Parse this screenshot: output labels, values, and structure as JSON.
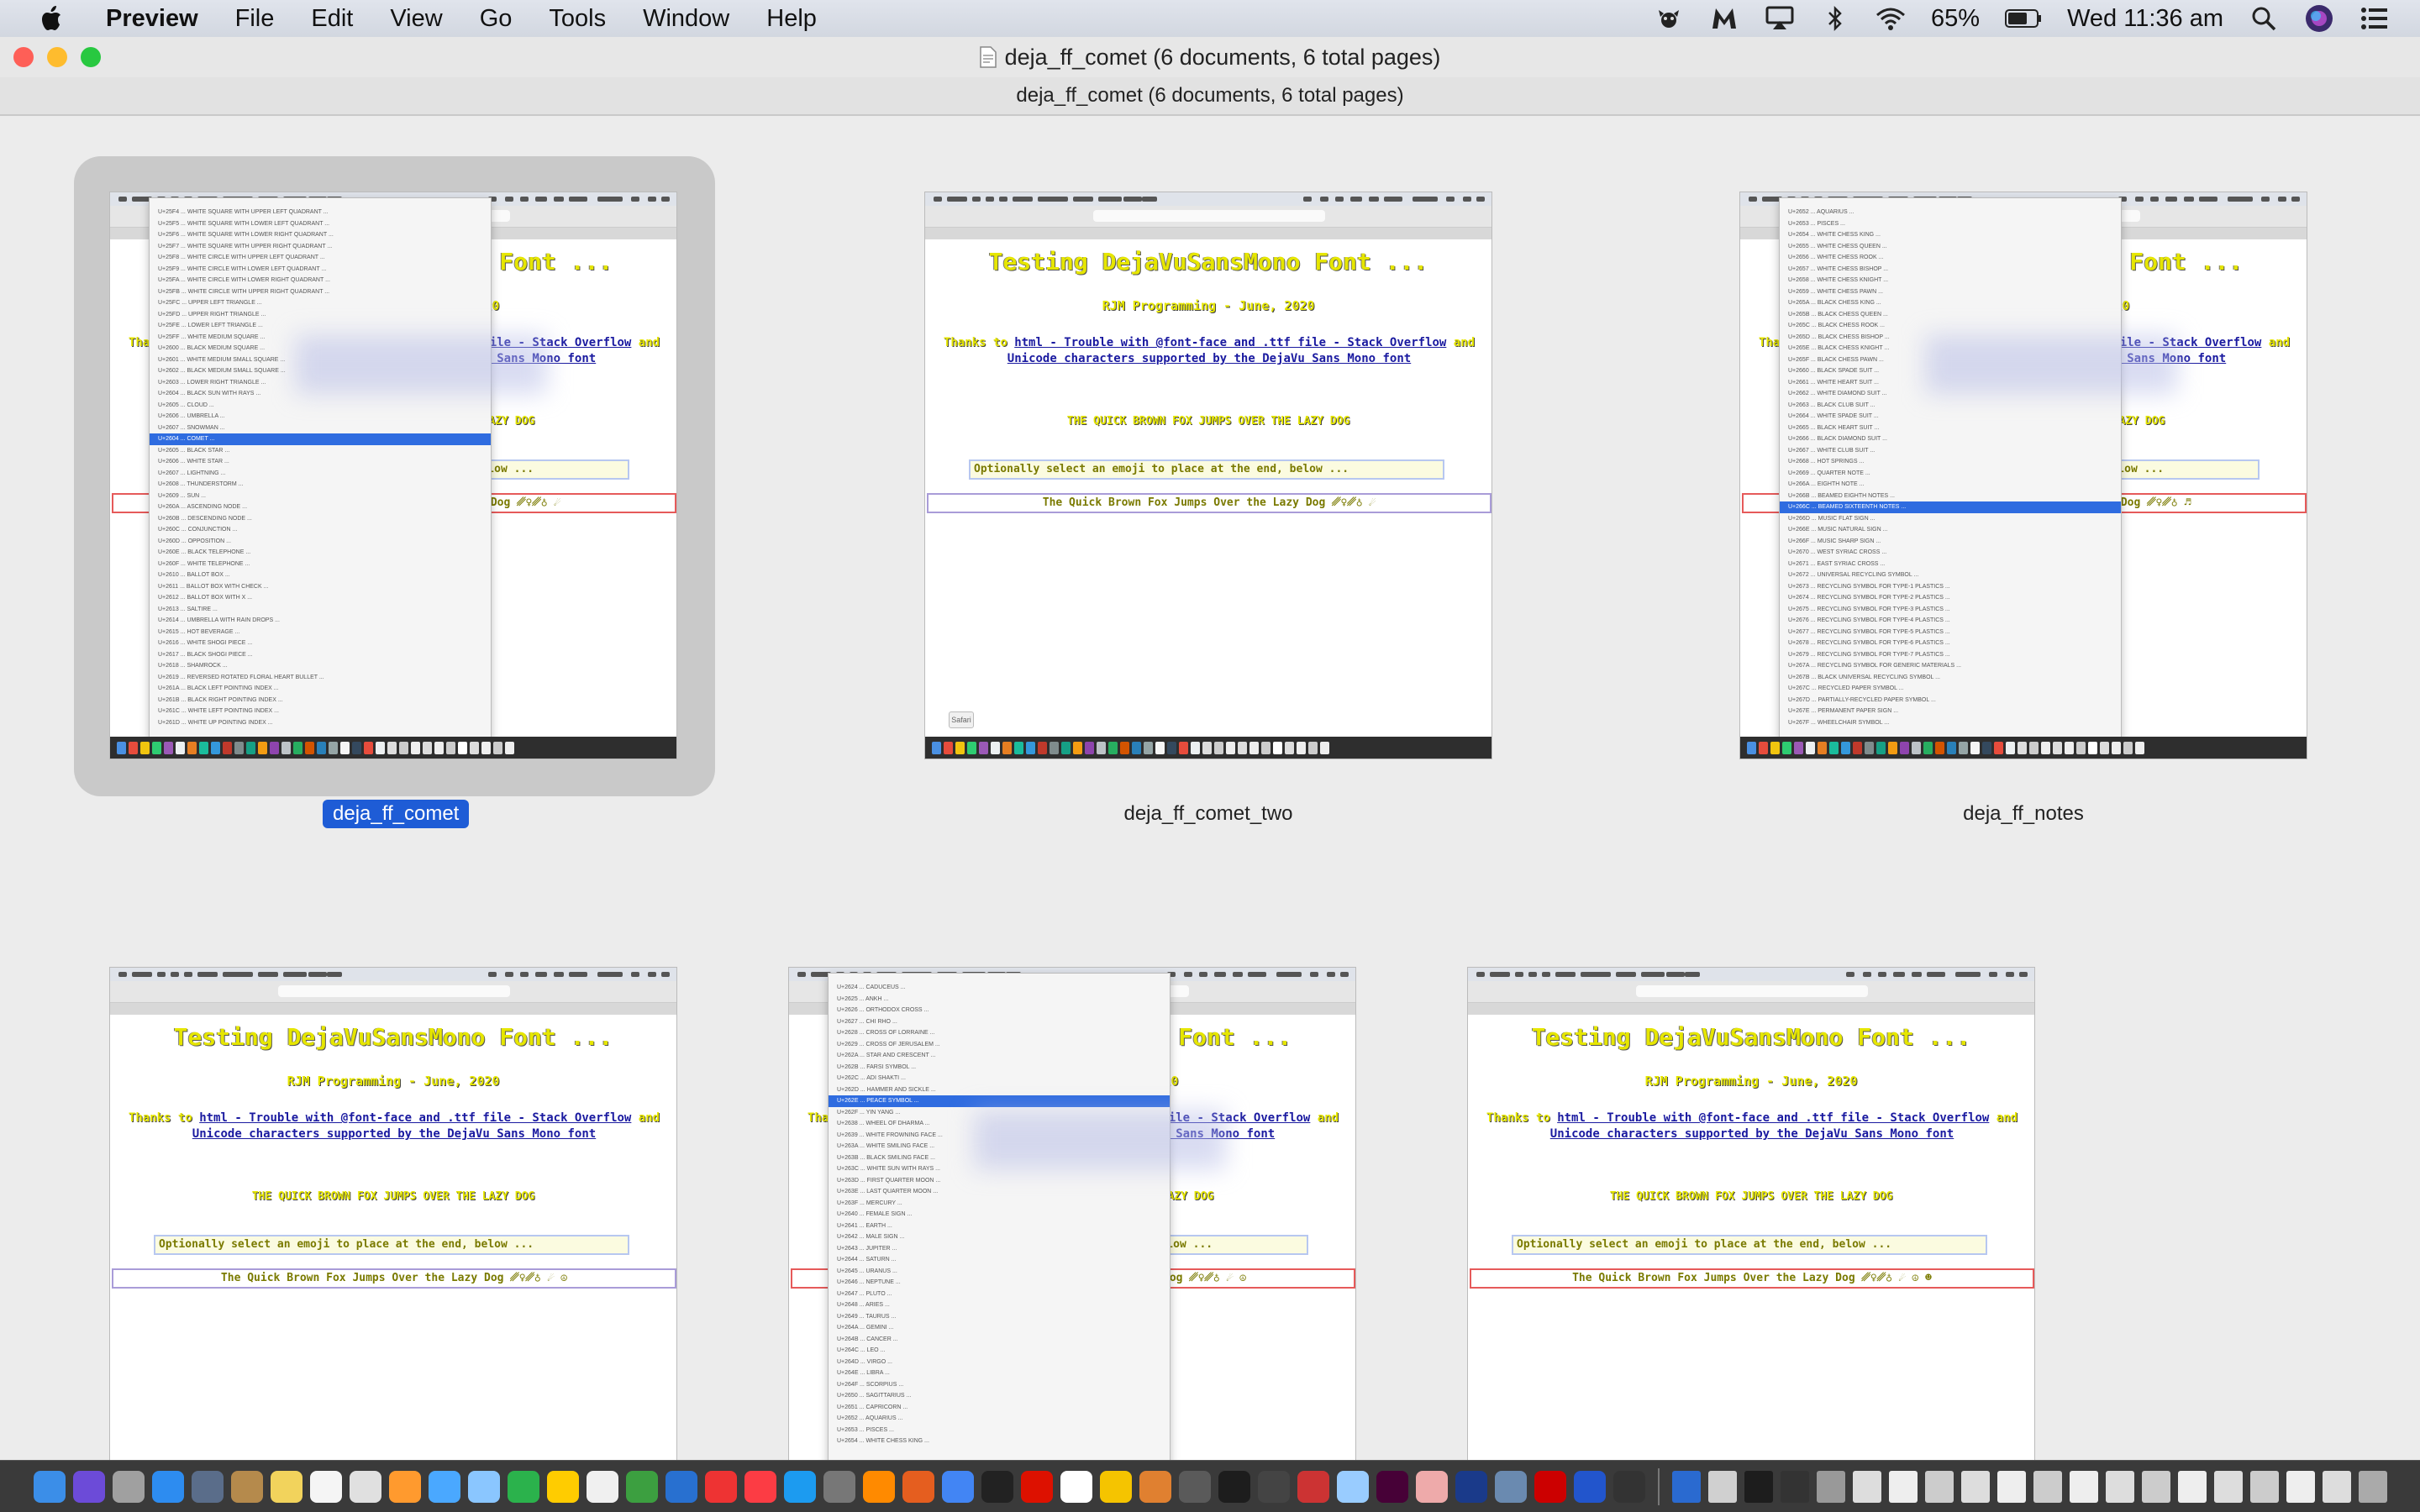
{
  "menubar": {
    "app_name": "Preview",
    "menus": [
      "File",
      "Edit",
      "View",
      "Go",
      "Tools",
      "Window",
      "Help"
    ],
    "battery": "65%",
    "clock": "Wed 11:36 am",
    "status_icons": [
      "automator-icon",
      "m-icon",
      "airplay-icon",
      "bluetooth-icon",
      "wifi-icon",
      "battery-icon",
      "search-icon",
      "siri-icon",
      "list-icon"
    ]
  },
  "window": {
    "title": "deja_ff_comet (6 documents, 6 total pages)",
    "subtitle": "deja_ff_comet (6 documents, 6 total pages)",
    "colors": {
      "close": "#fe5f57",
      "minimize": "#febc2e",
      "zoom": "#28c840",
      "selection": "#1e5cd6"
    }
  },
  "page_content": {
    "title": "Testing DejaVuSansMono Font ...",
    "byline": "RJM Programming - June, 2020",
    "thanks_prefix": "Thanks to",
    "link1": "html - Trouble with @font-face and .ttf file - Stack Overflow",
    "and": "and",
    "link2": "Unicode characters supported by the DejaVu Sans Mono font",
    "fox_caps": "THE QUICK BROWN FOX JUMPS OVER THE LAZY DOG",
    "select_prompt": "Optionally select an emoji to place at the end, below ...",
    "safari_button": "Safari"
  },
  "documents": [
    {
      "label": "deja_ff_comet",
      "output": "The Quick Brown Fox Jumps Over the Lazy Dog ␥♀␥♁ ☄",
      "selected": true
    },
    {
      "label": "deja_ff_comet_two",
      "output": "The Quick Brown Fox Jumps Over the Lazy Dog ␥♀␥♁ ☄",
      "selected": false
    },
    {
      "label": "deja_ff_notes",
      "output": "The Quick Brown Fox Jumps Over the Lazy Dog ␥♀␥♁ ♬",
      "selected": false
    },
    {
      "label": "",
      "output": "The Quick Brown Fox Jumps Over the Lazy Dog ␥♀␥♁ ☄ ☮",
      "selected": false
    },
    {
      "label": "",
      "output": "The Quick Brown Fox Jumps Over the Lazy Dog ␥♀␥♁ ☄ ☮",
      "selected": false
    },
    {
      "label": "",
      "output": "The Quick Brown Fox Jumps Over the Lazy Dog ␥♀␥♁ ☄ ☮ ☻",
      "selected": false
    }
  ],
  "dropdown_comet": {
    "rows": [
      "U+25F4 ... WHITE SQUARE WITH UPPER LEFT QUADRANT ...",
      "U+25F5 ... WHITE SQUARE WITH LOWER LEFT QUADRANT ...",
      "U+25F6 ... WHITE SQUARE WITH LOWER RIGHT QUADRANT ...",
      "U+25F7 ... WHITE SQUARE WITH UPPER RIGHT QUADRANT ...",
      "U+25F8 ... WHITE CIRCLE WITH UPPER LEFT QUADRANT ...",
      "U+25F9 ... WHITE CIRCLE WITH LOWER LEFT QUADRANT ...",
      "U+25FA ... WHITE CIRCLE WITH LOWER RIGHT QUADRANT ...",
      "U+25FB ... WHITE CIRCLE WITH UPPER RIGHT QUADRANT ...",
      "U+25FC ... UPPER LEFT TRIANGLE ...",
      "U+25FD ... UPPER RIGHT TRIANGLE ...",
      "U+25FE ... LOWER LEFT TRIANGLE ...",
      "U+25FF ... WHITE MEDIUM SQUARE ...",
      "U+2600 ... BLACK MEDIUM SQUARE ...",
      "U+2601 ... WHITE MEDIUM SMALL SQUARE ...",
      "U+2602 ... BLACK MEDIUM SMALL SQUARE ...",
      "U+2603 ... LOWER RIGHT TRIANGLE ...",
      "U+2604 ... BLACK SUN WITH RAYS ...",
      "U+2605 ... CLOUD ...",
      "U+2606 ... UMBRELLA ...",
      "U+2607 ... SNOWMAN ...",
      "U+2604 ... COMET ...",
      "U+2605 ... BLACK STAR ...",
      "U+2606 ... WHITE STAR ...",
      "U+2607 ... LIGHTNING ...",
      "U+2608 ... THUNDERSTORM ...",
      "U+2609 ... SUN ...",
      "U+260A ... ASCENDING NODE ...",
      "U+260B ... DESCENDING NODE ...",
      "U+260C ... CONJUNCTION ...",
      "U+260D ... OPPOSITION ...",
      "U+260E ... BLACK TELEPHONE ...",
      "U+260F ... WHITE TELEPHONE ...",
      "U+2610 ... BALLOT BOX ...",
      "U+2611 ... BALLOT BOX WITH CHECK ...",
      "U+2612 ... BALLOT BOX WITH X ...",
      "U+2613 ... SALTIRE ...",
      "U+2614 ... UMBRELLA WITH RAIN DROPS ...",
      "U+2615 ... HOT BEVERAGE ...",
      "U+2616 ... WHITE SHOGI PIECE ...",
      "U+2617 ... BLACK SHOGI PIECE ...",
      "U+2618 ... SHAMROCK ...",
      "U+2619 ... REVERSED ROTATED FLORAL HEART BULLET ...",
      "U+261A ... BLACK LEFT POINTING INDEX ...",
      "U+261B ... BLACK RIGHT POINTING INDEX ...",
      "U+261C ... WHITE LEFT POINTING INDEX ...",
      "U+261D ... WHITE UP POINTING INDEX ..."
    ],
    "highlight_index": 20
  },
  "dropdown_notes": {
    "rows": [
      "U+2652 ... AQUARIUS ...",
      "U+2653 ... PISCES ...",
      "U+2654 ... WHITE CHESS KING ...",
      "U+2655 ... WHITE CHESS QUEEN ...",
      "U+2656 ... WHITE CHESS ROOK ...",
      "U+2657 ... WHITE CHESS BISHOP ...",
      "U+2658 ... WHITE CHESS KNIGHT ...",
      "U+2659 ... WHITE CHESS PAWN ...",
      "U+265A ... BLACK CHESS KING ...",
      "U+265B ... BLACK CHESS QUEEN ...",
      "U+265C ... BLACK CHESS ROOK ...",
      "U+265D ... BLACK CHESS BISHOP ...",
      "U+265E ... BLACK CHESS KNIGHT ...",
      "U+265F ... BLACK CHESS PAWN ...",
      "U+2660 ... BLACK SPADE SUIT ...",
      "U+2661 ... WHITE HEART SUIT ...",
      "U+2662 ... WHITE DIAMOND SUIT ...",
      "U+2663 ... BLACK CLUB SUIT ...",
      "U+2664 ... WHITE SPADE SUIT ...",
      "U+2665 ... BLACK HEART SUIT ...",
      "U+2666 ... BLACK DIAMOND SUIT ...",
      "U+2667 ... WHITE CLUB SUIT ...",
      "U+2668 ... HOT SPRINGS ...",
      "U+2669 ... QUARTER NOTE ...",
      "U+266A ... EIGHTH NOTE ...",
      "U+266B ... BEAMED EIGHTH NOTES ...",
      "U+266C ... BEAMED SIXTEENTH NOTES ...",
      "U+266D ... MUSIC FLAT SIGN ...",
      "U+266E ... MUSIC NATURAL SIGN ...",
      "U+266F ... MUSIC SHARP SIGN ...",
      "U+2670 ... WEST SYRIAC CROSS ...",
      "U+2671 ... EAST SYRIAC CROSS ...",
      "U+2672 ... UNIVERSAL RECYCLING SYMBOL ...",
      "U+2673 ... RECYCLING SYMBOL FOR TYPE-1 PLASTICS ...",
      "U+2674 ... RECYCLING SYMBOL FOR TYPE-2 PLASTICS ...",
      "U+2675 ... RECYCLING SYMBOL FOR TYPE-3 PLASTICS ...",
      "U+2676 ... RECYCLING SYMBOL FOR TYPE-4 PLASTICS ...",
      "U+2677 ... RECYCLING SYMBOL FOR TYPE-5 PLASTICS ...",
      "U+2678 ... RECYCLING SYMBOL FOR TYPE-6 PLASTICS ...",
      "U+2679 ... RECYCLING SYMBOL FOR TYPE-7 PLASTICS ...",
      "U+267A ... RECYCLING SYMBOL FOR GENERIC MATERIALS ...",
      "U+267B ... BLACK UNIVERSAL RECYCLING SYMBOL ...",
      "U+267C ... RECYCLED PAPER SYMBOL ...",
      "U+267D ... PARTIALLY-RECYCLED PAPER SYMBOL ...",
      "U+267E ... PERMANENT PAPER SIGN ...",
      "U+267F ... WHEELCHAIR SYMBOL ..."
    ],
    "highlight_index": 26
  },
  "dropdown_peace": {
    "rows": [
      "U+2624 ... CADUCEUS ...",
      "U+2625 ... ANKH ...",
      "U+2626 ... ORTHODOX CROSS ...",
      "U+2627 ... CHI RHO ...",
      "U+2628 ... CROSS OF LORRAINE ...",
      "U+2629 ... CROSS OF JERUSALEM ...",
      "U+262A ... STAR AND CRESCENT ...",
      "U+262B ... FARSI SYMBOL ...",
      "U+262C ... ADI SHAKTI ...",
      "U+262D ... HAMMER AND SICKLE ...",
      "U+262E ... PEACE SYMBOL ...",
      "U+262F ... YIN YANG ...",
      "U+2638 ... WHEEL OF DHARMA ...",
      "U+2639 ... WHITE FROWNING FACE ...",
      "U+263A ... WHITE SMILING FACE ...",
      "U+263B ... BLACK SMILING FACE ...",
      "U+263C ... WHITE SUN WITH RAYS ...",
      "U+263D ... FIRST QUARTER MOON ...",
      "U+263E ... LAST QUARTER MOON ...",
      "U+263F ... MERCURY ...",
      "U+2640 ... FEMALE SIGN ...",
      "U+2641 ... EARTH ...",
      "U+2642 ... MALE SIGN ...",
      "U+2643 ... JUPITER ...",
      "U+2644 ... SATURN ...",
      "U+2645 ... URANUS ...",
      "U+2646 ... NEPTUNE ...",
      "U+2647 ... PLUTO ...",
      "U+2648 ... ARIES ...",
      "U+2649 ... TAURUS ...",
      "U+264A ... GEMINI ...",
      "U+264B ... CANCER ...",
      "U+264C ... LEO ...",
      "U+264D ... VIRGO ...",
      "U+264E ... LIBRA ...",
      "U+264F ... SCORPIUS ...",
      "U+2650 ... SAGITTARIUS ...",
      "U+2651 ... CAPRICORN ...",
      "U+2652 ... AQUARIUS ...",
      "U+2653 ... PISCES ...",
      "U+2654 ... WHITE CHESS KING ..."
    ],
    "highlight_index": 10
  },
  "dock_colors": [
    "#3b8ee8",
    "#6c4bd8",
    "#a0a0a0",
    "#2d8cf0",
    "#5a6d8a",
    "#b58a4c",
    "#f2d35c",
    "#f5f5f5",
    "#e0e0e0",
    "#ff9a2e",
    "#4aa8ff",
    "#8ac6ff",
    "#2bb24c",
    "#ffcc00",
    "#f0f0f0",
    "#3c9f40",
    "#2870d0",
    "#e33",
    "#fc3c44",
    "#1c9bf0",
    "#777",
    "#ff8a00",
    "#e55e1f",
    "#4285f4",
    "#222",
    "#d10",
    "#fff",
    "#f5c400",
    "#e08030",
    "#5a5a5a",
    "#1d1d1d",
    "#444",
    "#c33",
    "#9cf",
    "#470137",
    "#eaa",
    "#1a3a8a",
    "#6a8ab0",
    "#c00",
    "#2255cc",
    "#333"
  ],
  "dock_recent_colors": [
    "#2a6ad0",
    "#d0d0d0",
    "#1d1d1d",
    "#333",
    "#999",
    "#ddd",
    "#eee",
    "#ccc",
    "#ddd",
    "#eee",
    "#ccc",
    "#eee",
    "#ddd",
    "#ccc",
    "#eee",
    "#ddd",
    "#ccc",
    "#eee",
    "#ddd",
    "#aaa"
  ],
  "thumb_dock_colors": [
    "#4a90e2",
    "#e74c3c",
    "#f1c40f",
    "#2ecc71",
    "#9b59b6",
    "#ecf0f1",
    "#e67e22",
    "#1abc9c",
    "#3498db",
    "#c0392b",
    "#7f8c8d",
    "#16a085",
    "#f39c12",
    "#8e44ad",
    "#bdc3c7",
    "#27ae60",
    "#d35400",
    "#2980b9",
    "#95a5a6",
    "#f5f5f5",
    "#34495e",
    "#e74c3c",
    "#ecf0f1",
    "#ddd",
    "#ccc",
    "#eee",
    "#ddd",
    "#eee",
    "#ccc",
    "#fff",
    "#ddd",
    "#eee",
    "#ccc",
    "#eee"
  ]
}
